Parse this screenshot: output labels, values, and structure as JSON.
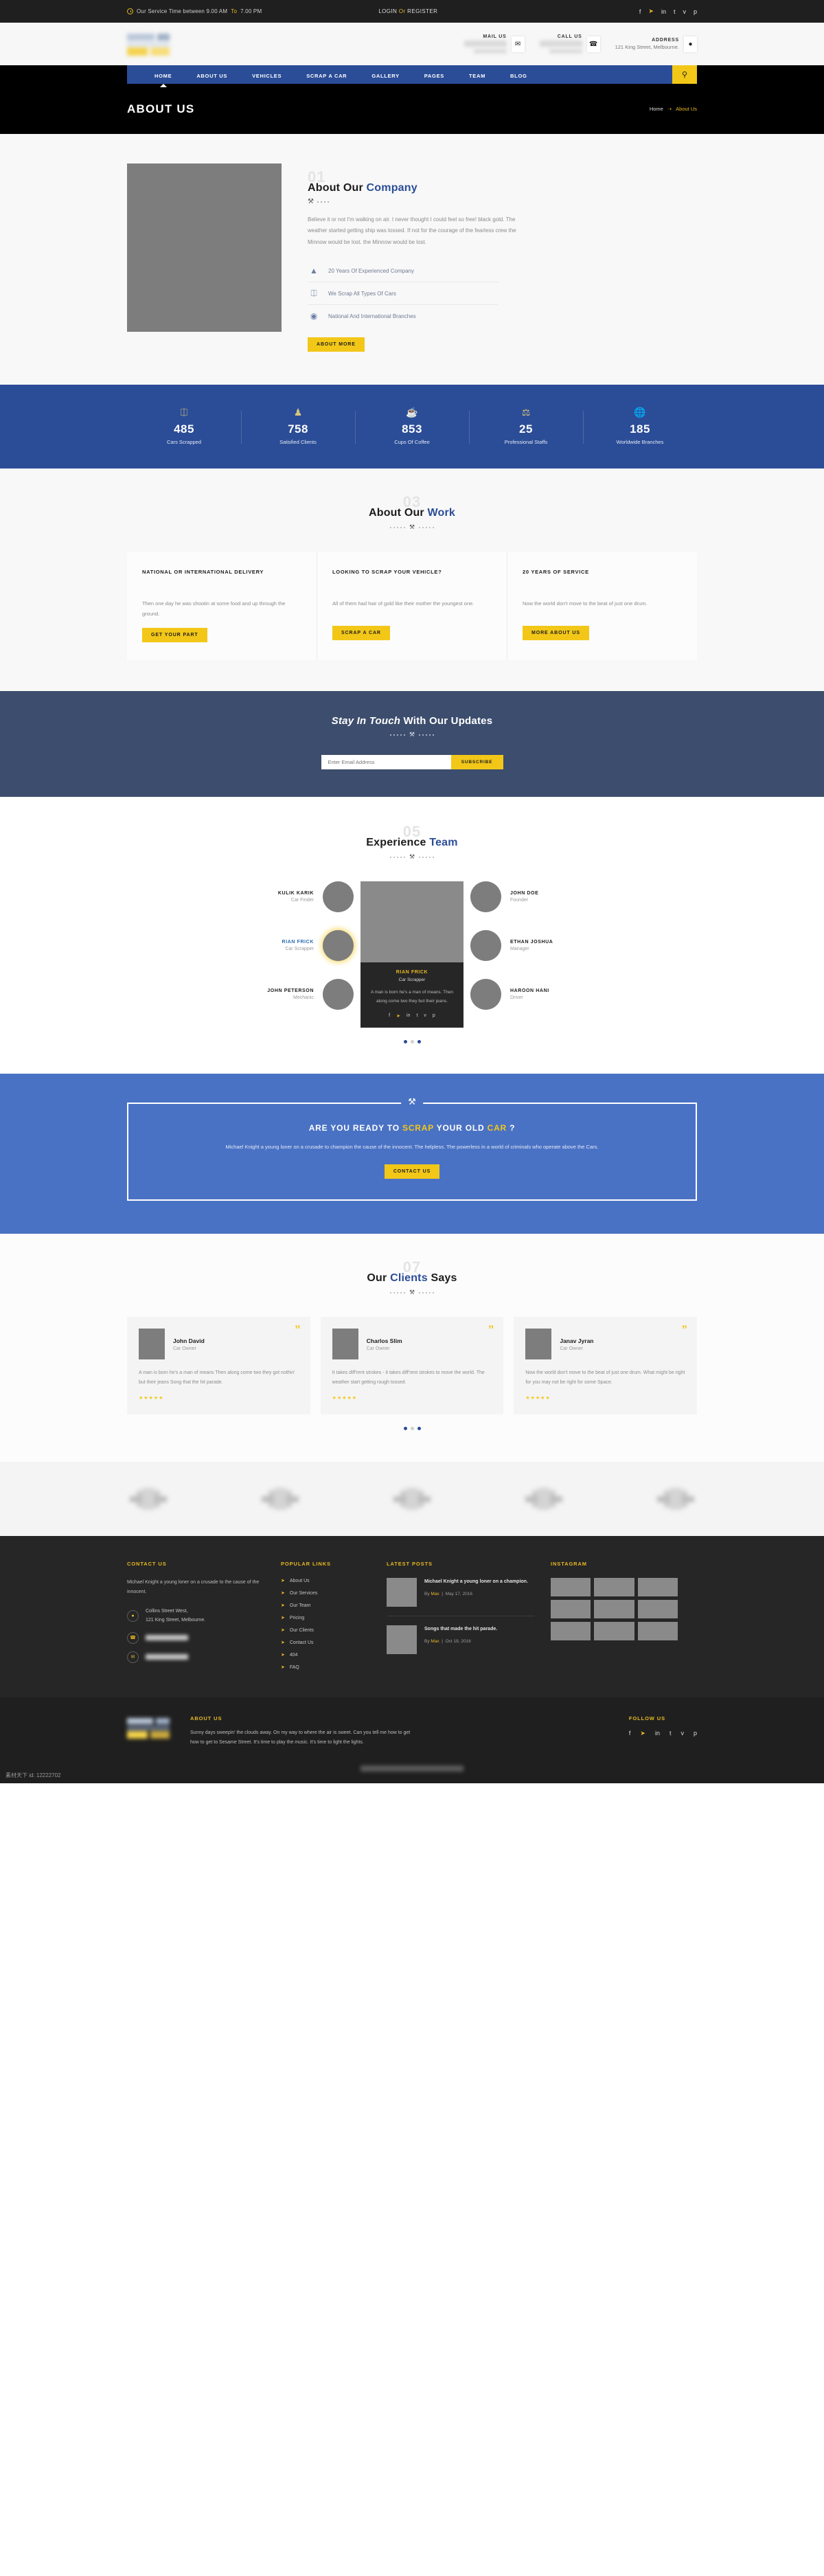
{
  "topbar": {
    "service_time": "Our Service Time between 9.00 AM To 7.00 PM",
    "service_time_parts": {
      "a": "Our Service Time between 9.00 AM",
      "to": "To",
      "b": "7.00 PM"
    },
    "login": "LOGIN",
    "or": "Or",
    "register": "REGISTER",
    "social": [
      "f",
      "t",
      "in",
      "t",
      "v",
      "p"
    ]
  },
  "header": {
    "mail": {
      "label": "MAIL US",
      "value": "",
      "icon": "envelope-icon"
    },
    "call": {
      "label": "CALL US",
      "value": "",
      "icon": "phone-icon"
    },
    "address": {
      "label": "ADDRESS",
      "value": "121 King Street, Melbourne.",
      "icon": "location-icon"
    }
  },
  "nav": {
    "items": [
      "HOME",
      "ABOUT US",
      "VEHICLES",
      "SCRAP A CAR",
      "GALLERY",
      "PAGES",
      "TEAM",
      "BLOG"
    ],
    "active": "HOME",
    "search_icon": "search-icon"
  },
  "page_header": {
    "title": "ABOUT US",
    "breadcrumb_home": "Home",
    "breadcrumb_sep": "➝",
    "breadcrumb_current": "About Us"
  },
  "about": {
    "number": "01",
    "heading_a": "About Our ",
    "heading_b": "Company",
    "paragraph": "Believe it or not I'm walking on air. I never thought I could feel so free! black gold. The weather started getting ship was tossed. If not for the courage of the fearless crew the Minnow would be lost. the Minnow would be lost.",
    "features": [
      {
        "icon": "chart-bars-icon",
        "text": "20 Years Of Experienced Company"
      },
      {
        "icon": "car-icon",
        "text": "We Scrap All Types Of Cars"
      },
      {
        "icon": "globe-icon",
        "text": "National And International Branches"
      }
    ],
    "button": "ABOUT MORE"
  },
  "counters": [
    {
      "icon": "car-icon",
      "value": "485",
      "label": "Cars Scrapped"
    },
    {
      "icon": "user-icon",
      "value": "758",
      "label": "Satisfied Clients"
    },
    {
      "icon": "coffee-icon",
      "value": "853",
      "label": "Cups Of Coffee"
    },
    {
      "icon": "badge-icon",
      "value": "25",
      "label": "Professional Staffs"
    },
    {
      "icon": "globe-icon",
      "value": "185",
      "label": "Worldwide Branches"
    }
  ],
  "work": {
    "number": "03",
    "heading_a": "About Our ",
    "heading_b": "Work",
    "cards": [
      {
        "title": "NATIONAL OR INTERNATIONAL DELIVERY",
        "text": "Then one day he was shootin at some food and up through the ground.",
        "button": "GET YOUR PART"
      },
      {
        "title": "LOOKING TO SCRAP YOUR VEHICLE?",
        "text": "All of them had hair of gold like their mother the youngest one.",
        "button": "SCRAP A CAR"
      },
      {
        "title": "20 YEARS OF SERVICE",
        "text": "Now the world don't move to the beat of just one drum.",
        "button": "MORE ABOUT US"
      }
    ]
  },
  "newsletter": {
    "heading_em": "Stay In Touch",
    "heading_rest": " With Our Updates",
    "placeholder": "Enter Email Address",
    "value": "",
    "button": "SUBSCRIBE"
  },
  "team": {
    "number": "05",
    "heading_a": "Experience ",
    "heading_b": "Team",
    "left": [
      {
        "name": "KULIK KARIK",
        "role": "Car Finder",
        "active": false
      },
      {
        "name": "RIAN FRICK",
        "role": "Car Scrapper",
        "active": true
      },
      {
        "name": "JOHN PETERSON",
        "role": "Mechanic",
        "active": false
      }
    ],
    "right": [
      {
        "name": "JOHN DOE",
        "role": "Founder",
        "active": false
      },
      {
        "name": "ETHAN JOSHUA",
        "role": "Manager",
        "active": false
      },
      {
        "name": "HAROON HANI",
        "role": "Driver",
        "active": false
      }
    ],
    "feature": {
      "name": "RIAN FRICK",
      "role": "Car Scrapper",
      "desc": "A man is born he's a man of means. Then along come two they but their jeans.",
      "social": [
        "f",
        "t",
        "in",
        "t",
        "v",
        "p"
      ]
    }
  },
  "cta": {
    "h_a": "ARE YOU READY TO ",
    "h_scrap": "SCRAP",
    "h_b": " YOUR OLD ",
    "h_car": "CAR",
    "h_c": " ?",
    "text": "Michael Knight a young loner on a crusade to champion the cause of the innocent. The helpless. The powerless in a world of criminals who operate above the Cars.",
    "button": "CONTACT US"
  },
  "testimonials": {
    "number": "07",
    "heading_a": "Our ",
    "heading_b": "Clients",
    "heading_c": " Says",
    "items": [
      {
        "name": "John David",
        "role": "Car Owner",
        "text": "A man is born he's a man of means Then along come two they got nothin' but their jeans Song that the hit parade.",
        "stars": "★★★★★"
      },
      {
        "name": "Charlos Slim",
        "role": "Car Owner",
        "text": "It takes diff'rent strokes - it takes diff'rent strokes to move the world. The weather start getting rough tossed.",
        "stars": "★★★★★"
      },
      {
        "name": "Janav Jyran",
        "role": "Car Owner",
        "text": "Now the world don't move to the beat of just one drum. What might be right for you may not be right for some Space.",
        "stars": "★★★★★"
      }
    ]
  },
  "footer": {
    "contact": {
      "title": "CONTACT US",
      "text": "Michael Knight a young loner on a crusade to the cause of the innocent.",
      "address": "Collins Street West,\n121 King Street, Melbourne.",
      "address_l1": "Collins Street West,",
      "address_l2": "121 King Street, Melbourne.",
      "phone": "",
      "email": ""
    },
    "links": {
      "title": "POPULAR LINKS",
      "items": [
        "About Us",
        "Our Services",
        "Our Team",
        "Pricing",
        "Our Clients",
        "Contact Us",
        "404",
        "FAQ"
      ]
    },
    "posts": {
      "title": "LATEST POSTS",
      "items": [
        {
          "title": "Michael Knight a young loner on a champion.",
          "by_label": "By",
          "by": "Max",
          "date": "May 17, 2016"
        },
        {
          "title": "Songs that made the hit parade.",
          "by_label": "By",
          "by": "Max",
          "date": "Oct 18, 2016"
        }
      ]
    },
    "instagram": {
      "title": "INSTAGRAM",
      "count": 9
    }
  },
  "bottom": {
    "about_title": "ABOUT US",
    "about_text": "Sunny days sweepin' the clouds away. On my way to where the air is sweet. Can you tell me how to get how to get to Sesame Street. It's time to play the music. It's time to light the lights.",
    "follow_title": "FOLLOW US",
    "social": [
      "f",
      "t",
      "in",
      "t",
      "v",
      "p"
    ]
  },
  "watermark": "素材天下 id: 12222702"
}
